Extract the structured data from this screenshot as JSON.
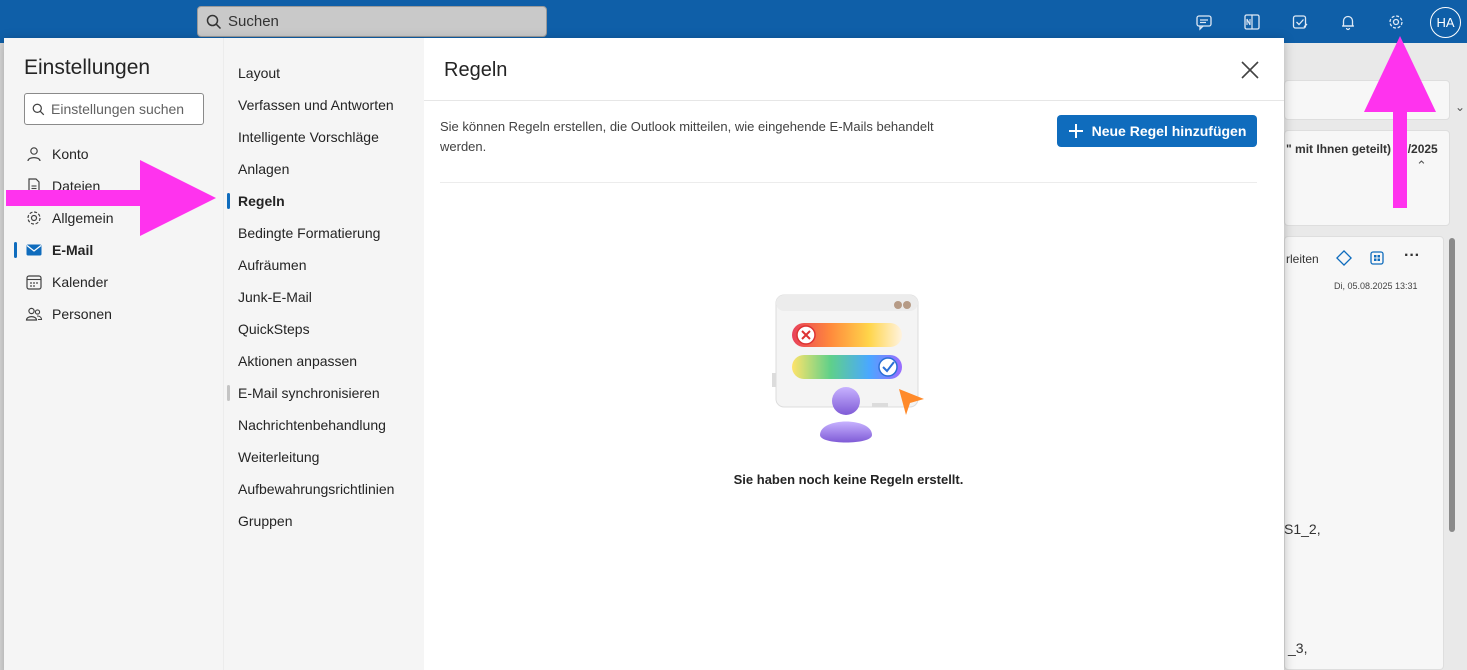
{
  "topbar": {
    "search_label": "Suchen",
    "avatar_initials": "HA"
  },
  "background": {
    "snippet1": "\" mit Ihnen geteilt) 8.  /2025",
    "forward_label": "rleiten",
    "date": "Di, 05.08.2025 13:31",
    "snippet2": "S1_2,",
    "snippet3": "_3,"
  },
  "settings": {
    "title": "Einstellungen",
    "search_placeholder": "Einstellungen suchen",
    "categories": [
      {
        "label": "Konto",
        "icon": "person-icon"
      },
      {
        "label": "Dateien",
        "icon": "document-icon"
      },
      {
        "label": "Allgemein",
        "icon": "gear-icon"
      },
      {
        "label": "E-Mail",
        "icon": "mail-icon"
      },
      {
        "label": "Kalender",
        "icon": "calendar-icon"
      },
      {
        "label": "Personen",
        "icon": "people-icon"
      }
    ],
    "subcategories": [
      "Layout",
      "Verfassen und Antworten",
      "Intelligente Vorschläge",
      "Anlagen",
      "Regeln",
      "Bedingte Formatierung",
      "Aufräumen",
      "Junk-E-Mail",
      "QuickSteps",
      "Aktionen anpassen",
      "E-Mail synchronisieren",
      "Nachrichtenbehandlung",
      "Weiterleitung",
      "Aufbewahrungsrichtlinien",
      "Gruppen"
    ]
  },
  "rules": {
    "title": "Regeln",
    "description": "Sie können Regeln erstellen, die Outlook mitteilen, wie eingehende E-Mails behandelt werden.",
    "add_button": "Neue Regel hinzufügen",
    "empty_message": "Sie haben noch keine Regeln erstellt."
  },
  "colors": {
    "topbar": "#0f5fa8",
    "accent": "#0f6cbd",
    "annotation": "#ff33ee"
  }
}
